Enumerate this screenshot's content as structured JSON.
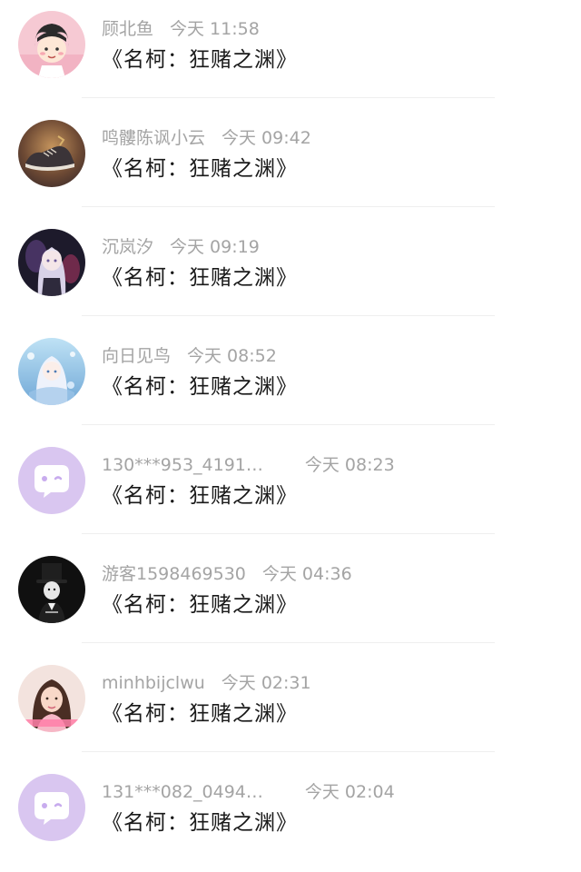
{
  "comments": [
    {
      "name": "顾北鱼",
      "time": "今天 11:58",
      "message": "《名柯：狂赌之渊》",
      "avatar": "cartoon-girl-avatar"
    },
    {
      "name": "鸣髏陈讽小云",
      "time": "今天 09:42",
      "message": "《名柯：狂赌之渊》",
      "avatar": "sneaker-photo-avatar"
    },
    {
      "name": "沉岚汐",
      "time": "今天 09:19",
      "message": "《名柯：狂赌之渊》",
      "avatar": "anime-girl-dark-avatar"
    },
    {
      "name": "向日见鸟",
      "time": "今天 08:52",
      "message": "《名柯：狂赌之渊》",
      "avatar": "anime-girl-blue-avatar"
    },
    {
      "name": "130***953_4191…",
      "time": "今天 08:23",
      "message": "《名柯：狂赌之渊》",
      "avatar": "default-chat-bubble-avatar"
    },
    {
      "name": "游客1598469530",
      "time": "今天 04:36",
      "message": "《名柯：狂赌之渊》",
      "avatar": "top-hat-figure-avatar"
    },
    {
      "name": "minhbijclwu",
      "time": "今天 02:31",
      "message": "《名柯：狂赌之渊》",
      "avatar": "woman-photo-avatar"
    },
    {
      "name": "131***082_0494…",
      "time": "今天 02:04",
      "message": "《名柯：狂赌之渊》",
      "avatar": "default-chat-bubble-avatar"
    }
  ]
}
